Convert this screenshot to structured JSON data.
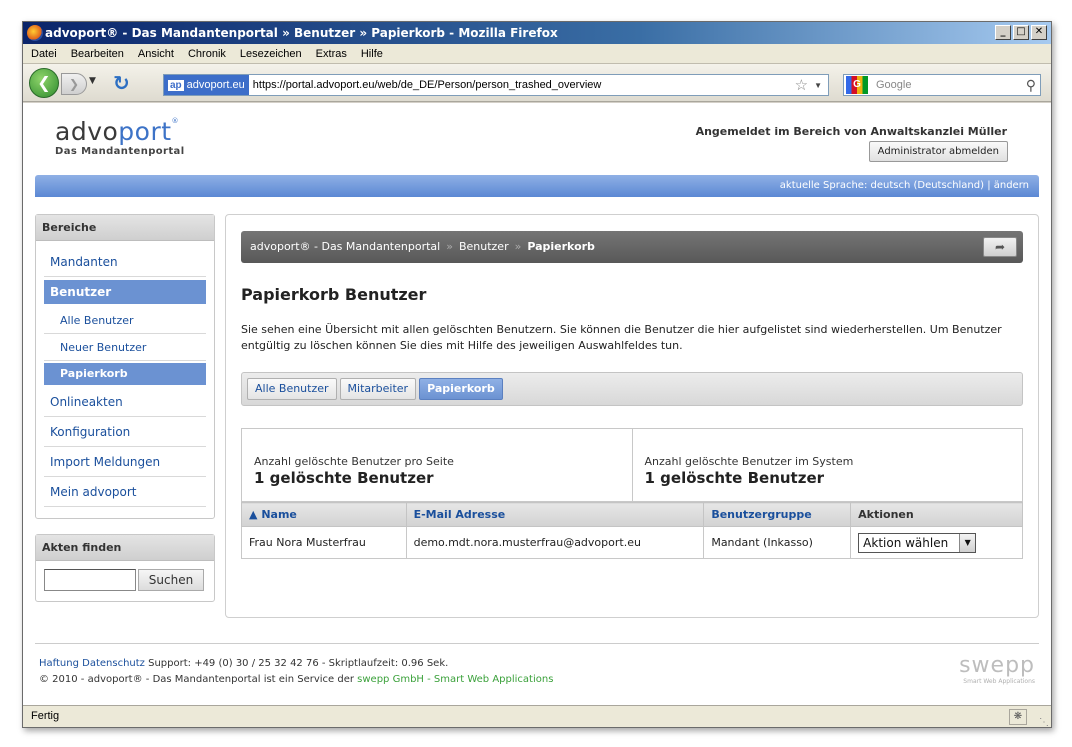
{
  "window": {
    "title": "advoport® - Das Mandantenportal » Benutzer » Papierkorb - Mozilla Firefox",
    "buttons": [
      "_",
      "□",
      "✕"
    ]
  },
  "menubar": [
    "Datei",
    "Bearbeiten",
    "Ansicht",
    "Chronik",
    "Lesezeichen",
    "Extras",
    "Hilfe"
  ],
  "nav": {
    "site_id": "advoport.eu",
    "site_badge": "ap",
    "url": "https://portal.advoport.eu/web/de_DE/Person/person_trashed_overview",
    "search_placeholder": "Google",
    "search_engine_badge": "G"
  },
  "header": {
    "brand_advo": "advo",
    "brand_port": "port",
    "brand_reg": "®",
    "subtitle": "Das Mandantenportal",
    "login_info": "Angemeldet im Bereich von Anwaltskanzlei Müller",
    "logout_label": "Administrator abmelden",
    "language_text": "aktuelle Sprache: deutsch (Deutschland) | ändern"
  },
  "sidebar": {
    "section_title": "Bereiche",
    "items": [
      {
        "label": "Mandanten"
      },
      {
        "label": "Benutzer"
      },
      {
        "label": "Alle Benutzer"
      },
      {
        "label": "Neuer Benutzer"
      },
      {
        "label": "Papierkorb"
      },
      {
        "label": "Onlineakten"
      },
      {
        "label": "Konfiguration"
      },
      {
        "label": "Import Meldungen"
      },
      {
        "label": "Mein advoport"
      }
    ],
    "find_title": "Akten finden",
    "find_value": "",
    "find_button": "Suchen"
  },
  "breadcrumb": {
    "items": [
      "advoport® - Das Mandantenportal",
      "Benutzer",
      "Papierkorb"
    ],
    "separator": "»"
  },
  "main": {
    "title": "Papierkorb Benutzer",
    "intro": "Sie sehen eine Übersicht mit allen gelöschten Benutzern. Sie können die Benutzer die hier aufgelistet sind wiederherstellen. Um Benutzer entgültig zu löschen können Sie dies mit Hilfe des jeweiligen Auswahlfeldes tun.",
    "tabs": [
      {
        "label": "Alle Benutzer"
      },
      {
        "label": "Mitarbeiter"
      },
      {
        "label": "Papierkorb"
      }
    ],
    "stats": [
      {
        "label": "Anzahl gelöschte Benutzer pro Seite",
        "value": "1 gelöschte Benutzer"
      },
      {
        "label": "Anzahl gelöschte Benutzer im System",
        "value": "1 gelöschte Benutzer"
      }
    ],
    "table": {
      "sort_indicator": "▲",
      "headers": [
        "Name",
        "E-Mail Adresse",
        "Benutzergruppe",
        "Aktionen"
      ],
      "rows": [
        {
          "name": "Frau Nora Musterfrau",
          "email": "demo.mdt.nora.musterfrau@advoport.eu",
          "group": "Mandant (Inkasso)",
          "action": "Aktion wählen"
        }
      ]
    }
  },
  "footer": {
    "link_haftung": "Haftung",
    "link_datenschutz": "Datenschutz",
    "support": "Support: +49 (0) 30 / 25 32 42 76 - Skriptlaufzeit: 0.96 Sek.",
    "copyright": "© 2010 - advoport® - Das Mandantenportal ist ein Service der",
    "swepp_link": "swepp GmbH - Smart Web Applications",
    "swepp_logo": "swepp",
    "swepp_tag": "Smart Web Applications"
  },
  "statusbar": {
    "text": "Fertig"
  },
  "colors": {
    "accent": "#6b92d2",
    "link": "#1a4f9c",
    "green": "#3ba13b"
  }
}
